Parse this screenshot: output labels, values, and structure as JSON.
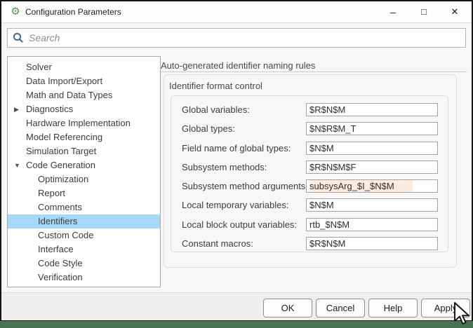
{
  "window": {
    "title": "Configuration Parameters"
  },
  "icons": {
    "gear": "⚙",
    "minimize": "–",
    "maximize": "□",
    "close": "✕",
    "collapsed": "▶",
    "expanded": "▼"
  },
  "search": {
    "placeholder": "Search"
  },
  "sidebar": {
    "items": [
      {
        "label": "Solver",
        "level": 0,
        "arrow": null,
        "selected": false
      },
      {
        "label": "Data Import/Export",
        "level": 0,
        "arrow": null,
        "selected": false
      },
      {
        "label": "Math and Data Types",
        "level": 0,
        "arrow": null,
        "selected": false
      },
      {
        "label": "Diagnostics",
        "level": 0,
        "arrow": "collapsed",
        "selected": false
      },
      {
        "label": "Hardware Implementation",
        "level": 0,
        "arrow": null,
        "selected": false
      },
      {
        "label": "Model Referencing",
        "level": 0,
        "arrow": null,
        "selected": false
      },
      {
        "label": "Simulation Target",
        "level": 0,
        "arrow": null,
        "selected": false
      },
      {
        "label": "Code Generation",
        "level": 0,
        "arrow": "expanded",
        "selected": false
      },
      {
        "label": "Optimization",
        "level": 1,
        "arrow": null,
        "selected": false
      },
      {
        "label": "Report",
        "level": 1,
        "arrow": null,
        "selected": false
      },
      {
        "label": "Comments",
        "level": 1,
        "arrow": null,
        "selected": false
      },
      {
        "label": "Identifiers",
        "level": 1,
        "arrow": null,
        "selected": true
      },
      {
        "label": "Custom Code",
        "level": 1,
        "arrow": null,
        "selected": false
      },
      {
        "label": "Interface",
        "level": 1,
        "arrow": null,
        "selected": false
      },
      {
        "label": "Code Style",
        "level": 1,
        "arrow": null,
        "selected": false
      },
      {
        "label": "Verification",
        "level": 1,
        "arrow": null,
        "selected": false
      }
    ]
  },
  "main": {
    "heading": "Auto-generated identifier naming rules",
    "group_title": "Identifier format control",
    "fields": [
      {
        "label": "Global variables:",
        "value": "$R$N$M",
        "highlighted": false
      },
      {
        "label": "Global types:",
        "value": "$N$R$M_T",
        "highlighted": false
      },
      {
        "label": "Field name of global types:",
        "value": "$N$M",
        "highlighted": false
      },
      {
        "label": "Subsystem methods:",
        "value": "$R$N$M$F",
        "highlighted": false
      },
      {
        "label": "Subsystem method arguments:",
        "value": "subsysArg_$I_$N$M",
        "highlighted": true
      },
      {
        "label": "Local temporary variables:",
        "value": "$N$M",
        "highlighted": false
      },
      {
        "label": "Local block output variables:",
        "value": "rtb_$N$M",
        "highlighted": false
      },
      {
        "label": "Constant macros:",
        "value": "$R$N$M",
        "highlighted": false
      }
    ]
  },
  "footer": {
    "buttons": [
      "OK",
      "Cancel",
      "Help",
      "Apply"
    ]
  },
  "colors": {
    "selection": "#a6d8f7",
    "modified_value_bg": "#fdecdd",
    "desktop_green": "#4a7451",
    "app_icon_green": "#4f9e47"
  }
}
